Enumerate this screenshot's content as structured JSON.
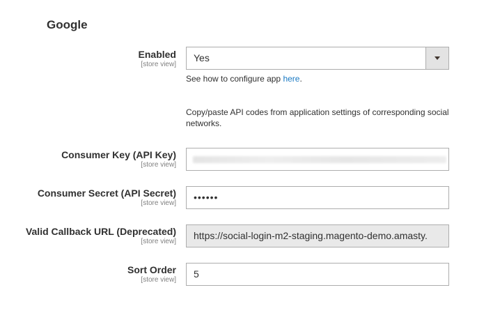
{
  "section": {
    "title": "Google"
  },
  "fields": {
    "enabled": {
      "label": "Enabled",
      "scope": "[store view]",
      "value": "Yes"
    },
    "configure_note": {
      "prefix": "See how to configure app ",
      "link": "here",
      "suffix": "."
    },
    "api_note": "Copy/paste API codes from application settings of corresponding social networks.",
    "consumer_key": {
      "label": "Consumer Key (API Key)",
      "scope": "[store view]",
      "value": ""
    },
    "consumer_secret": {
      "label": "Consumer Secret (API Secret)",
      "scope": "[store view]",
      "value": "••••••"
    },
    "callback_url": {
      "label": "Valid Callback URL (Deprecated)",
      "scope": "[store view]",
      "value": "https://social-login-m2-staging.magento-demo.amasty."
    },
    "sort_order": {
      "label": "Sort Order",
      "scope": "[store view]",
      "value": "5"
    }
  },
  "icons": {
    "select_arrow": "chevron-down-icon"
  }
}
